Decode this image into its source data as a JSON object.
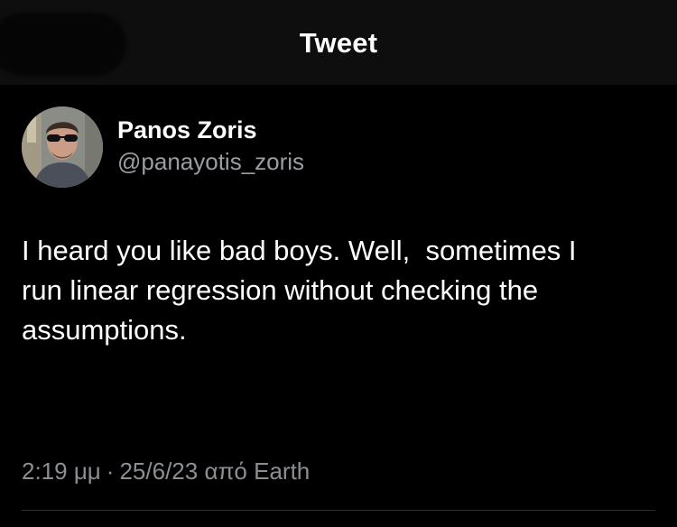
{
  "header": {
    "title": "Tweet"
  },
  "author": {
    "display_name": "Panos Zoris",
    "handle": "@panayotis_zoris",
    "avatar_icon": "profile-photo"
  },
  "tweet": {
    "text": "I heard you like bad boys. Well,  sometimes I\nrun linear regression without checking the\nassumptions."
  },
  "meta": {
    "time": "2:19 μμ",
    "separator": "·",
    "date": "25/6/23",
    "source_prefix": "από",
    "source": "Earth"
  },
  "colors": {
    "background": "#000000",
    "header_background": "#0e0e0e",
    "primary_text": "#ffffff",
    "secondary_text": "#9a9ea3"
  }
}
